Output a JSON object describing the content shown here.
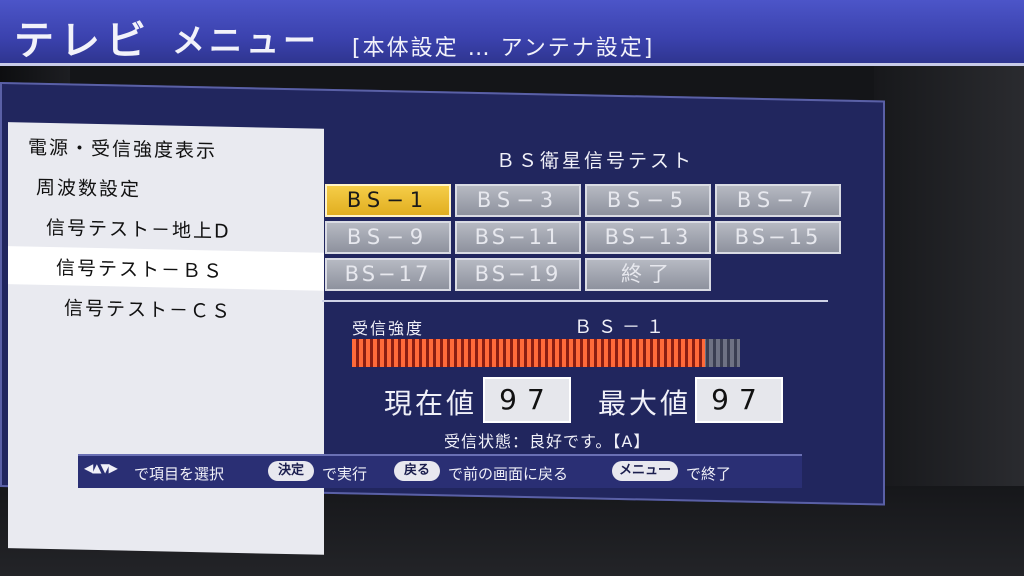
{
  "header": {
    "title": "テレビ",
    "menu": "メニュー",
    "path": "[本体設定 … アンテナ設定]"
  },
  "sidebar": {
    "items": [
      {
        "label": "電源・受信強度表示"
      },
      {
        "label": "周波数設定"
      },
      {
        "label": "信号テスト－地上D"
      },
      {
        "label": "信号テスト－ＢＳ",
        "selected": true
      },
      {
        "label": "信号テスト－ＣＳ"
      }
    ]
  },
  "panel": {
    "title": "ＢＳ衛星信号テスト",
    "channels": [
      {
        "label": "BS−1",
        "active": true
      },
      {
        "label": "BS−3"
      },
      {
        "label": "BS−5"
      },
      {
        "label": "BS−7"
      },
      {
        "label": "BS−9"
      },
      {
        "label": "BS−11"
      },
      {
        "label": "BS−13"
      },
      {
        "label": "BS−15"
      },
      {
        "label": "BS−17"
      },
      {
        "label": "BS−19"
      },
      {
        "label": "終了"
      }
    ],
    "signal_label": "受信強度",
    "signal_channel": "ＢＳ－１",
    "signal_level": 0.91,
    "current_label": "現在値",
    "current_value": "97",
    "max_label": "最大値",
    "max_value": "97",
    "status": "受信状態：良好です。【A】"
  },
  "footer": {
    "select_text": "で項目を選択",
    "enter_key": "決定",
    "enter_text": "で実行",
    "back_key": "戻る",
    "back_text": "で前の画面に戻る",
    "menu_key": "メニュー",
    "menu_text": "で終了"
  },
  "colors": {
    "titlebar": "#3b42ae",
    "panel_bg": "#21265e",
    "active_channel": "#f0c23a",
    "signal_bar": "#ff6a3a"
  }
}
